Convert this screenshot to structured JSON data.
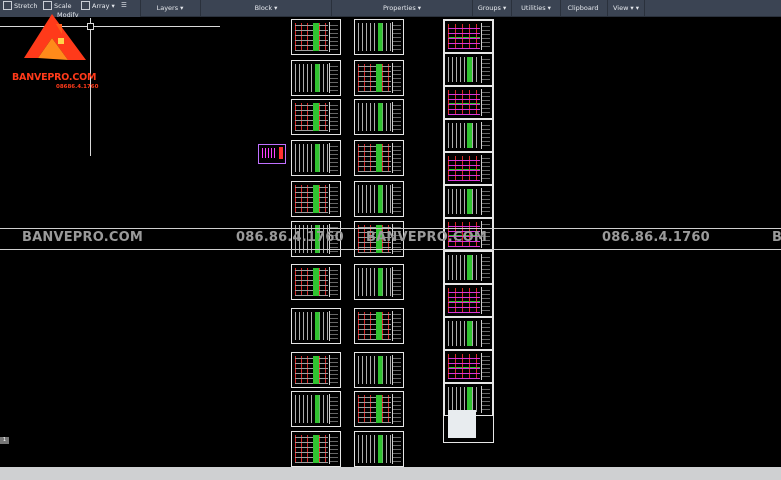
{
  "ribbon": {
    "modify_buttons": [
      {
        "label": "Stretch",
        "icon": "stretch-icon"
      },
      {
        "label": "Scale",
        "icon": "scale-icon"
      },
      {
        "label": "Array",
        "icon": "array-icon"
      }
    ],
    "modify_label": "Modify",
    "panels": [
      {
        "label": "Layers"
      },
      {
        "label": "Block"
      },
      {
        "label": "Properties"
      },
      {
        "label": "Groups"
      },
      {
        "label": "Utilities"
      },
      {
        "label": "Clipboard"
      },
      {
        "label": "View"
      }
    ]
  },
  "logo": {
    "brand": "BANVEPRO.COM",
    "phone": "08686.4.1760"
  },
  "watermark": {
    "items": [
      {
        "text": "BANVEPRO.COM"
      },
      {
        "text": "086.86.4.1760"
      },
      {
        "text": "BANVEPRO.COM"
      },
      {
        "text": "086.86.4.1760"
      },
      {
        "text": "B"
      }
    ]
  },
  "statusbar": {
    "indicator": "1"
  },
  "colors": {
    "ribbon_bg": "#3b4453",
    "canvas_bg": "#000000",
    "accent_green": "#39e639",
    "accent_red": "#ff3030",
    "accent_magenta": "#ff40ff",
    "logo_orange": "#ff3a1a"
  }
}
